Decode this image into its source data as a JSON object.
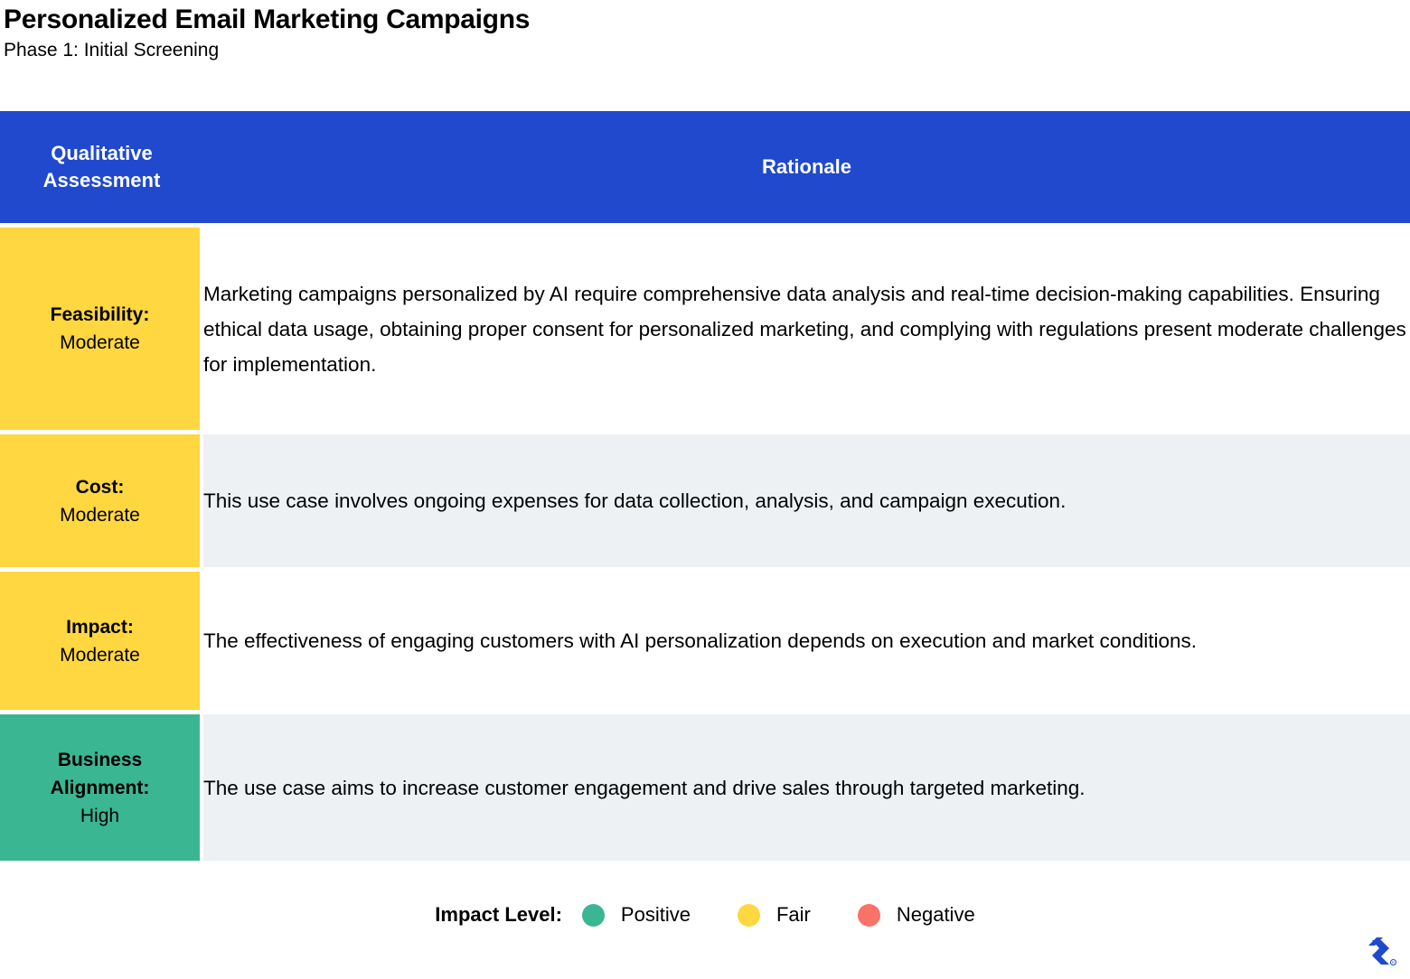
{
  "header": {
    "title": "Personalized Email Marketing Campaigns",
    "subtitle": "Phase 1: Initial Screening"
  },
  "table": {
    "columns": {
      "assessment": "Qualitative\nAssessment",
      "assessment_line1": "Qualitative",
      "assessment_line2": "Assessment",
      "rationale": "Rationale"
    },
    "rows": [
      {
        "label_key": "Feasibility:",
        "label_value": "Moderate",
        "label_color": "#FFD740",
        "row_color": "#FFFFFF",
        "rationale": "Marketing campaigns personalized by AI require comprehensive data analysis and real-time decision-making capabilities. Ensuring ethical data usage, obtaining proper consent for personalized marketing, and complying with regulations present moderate challenges for implementation."
      },
      {
        "label_key": "Cost:",
        "label_value": "Moderate",
        "label_color": "#FFD740",
        "row_color": "#EDF1F4",
        "rationale": "This use case involves ongoing expenses for data collection, analysis, and campaign execution."
      },
      {
        "label_key": "Impact:",
        "label_value": "Moderate",
        "label_color": "#FFD740",
        "row_color": "#FFFFFF",
        "rationale": "The effectiveness of engaging customers with AI personalization depends on execution and market conditions."
      },
      {
        "label_key": "Business Alignment:",
        "label_key_line1": "Business",
        "label_key_line2": "Alignment:",
        "label_value": "High",
        "label_color": "#3BB693",
        "row_color": "#EDF1F4",
        "rationale": "The use case aims to increase customer engagement and drive sales through targeted marketing."
      }
    ]
  },
  "legend": {
    "title": "Impact Level:",
    "items": [
      {
        "label": "Positive",
        "color": "#3BB693"
      },
      {
        "label": "Fair",
        "color": "#FFD740"
      },
      {
        "label": "Negative",
        "color": "#FA7268"
      }
    ]
  },
  "colors": {
    "header_blue": "#2049CE",
    "fair_yellow": "#FFD740",
    "positive_green": "#3BB693",
    "negative_red": "#FA7268",
    "row_gray": "#EDF1F4",
    "logo_blue": "#2049CE"
  }
}
